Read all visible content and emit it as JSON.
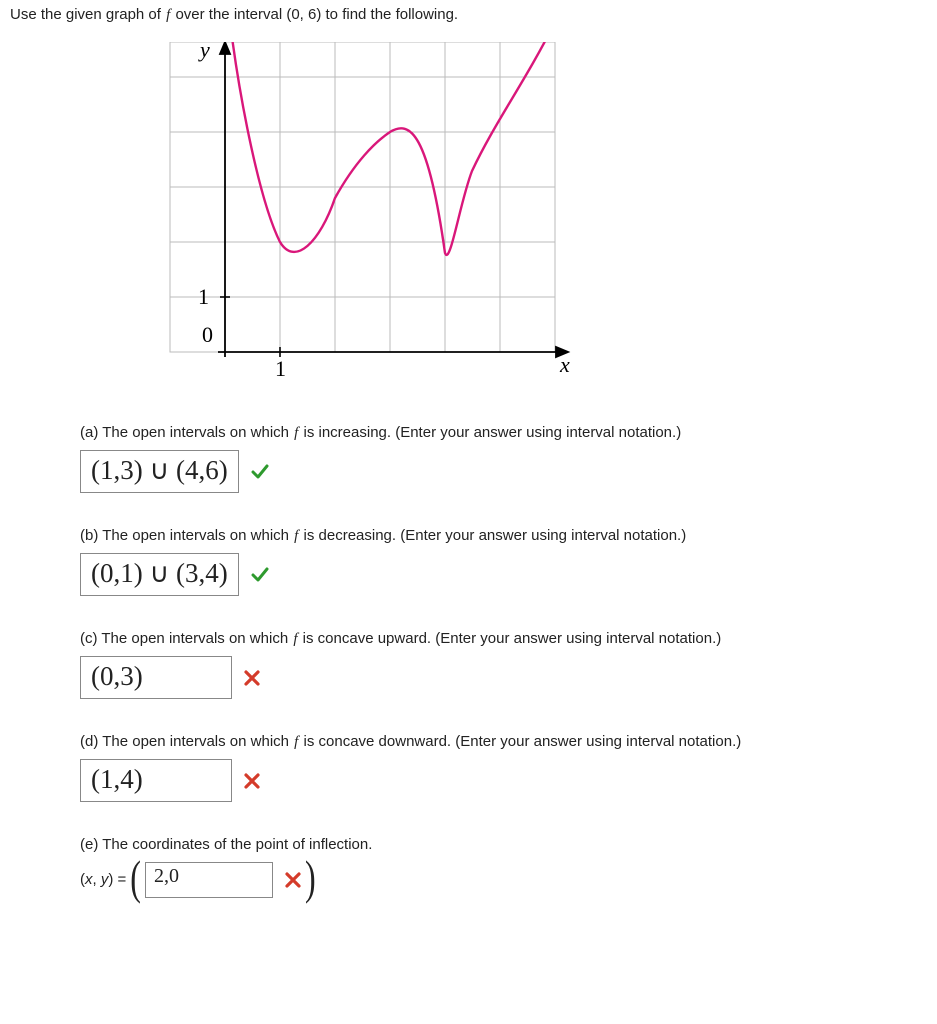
{
  "prompt": "Use the given graph of f over the interval (0, 6) to find the following.",
  "graph": {
    "y_label": "y",
    "x_label": "x",
    "origin_label": "0",
    "x_tick_label": "1",
    "y_tick_label": "1"
  },
  "parts": {
    "a": {
      "question_pre": "(a) The open intervals on which ",
      "question_post": " is increasing. (Enter your answer using interval notation.)",
      "answer": "(1,3) ∪ (4,6)",
      "correct": true
    },
    "b": {
      "question_pre": "(b) The open intervals on which ",
      "question_post": " is decreasing. (Enter your answer using interval notation.)",
      "answer": "(0,1) ∪ (3,4)",
      "correct": true
    },
    "c": {
      "question_pre": "(c) The open intervals on which ",
      "question_post": " is concave upward. (Enter your answer using interval notation.)",
      "answer": "(0,3)",
      "correct": false
    },
    "d": {
      "question_pre": "(d) The open intervals on which ",
      "question_post": " is concave downward. (Enter your answer using interval notation.)",
      "answer": "(1,4)",
      "correct": false
    },
    "e": {
      "question": "(e) The coordinates of the point of inflection.",
      "prefix": "(x, y) = ",
      "answer": "2,0",
      "correct": false
    }
  },
  "chart_data": {
    "type": "line",
    "title": "",
    "xlabel": "x",
    "ylabel": "y",
    "xlim": [
      -1,
      6
    ],
    "ylim": [
      -1,
      6
    ],
    "grid": true,
    "series": [
      {
        "name": "f",
        "x": [
          0,
          0.5,
          1,
          1.5,
          2,
          2.5,
          3,
          3.5,
          4,
          4.5,
          5,
          5.5,
          6
        ],
        "y": [
          6,
          3.8,
          2,
          2.1,
          2.8,
          3.6,
          4,
          3.6,
          1.8,
          3.3,
          4.2,
          5.2,
          6
        ]
      }
    ]
  }
}
